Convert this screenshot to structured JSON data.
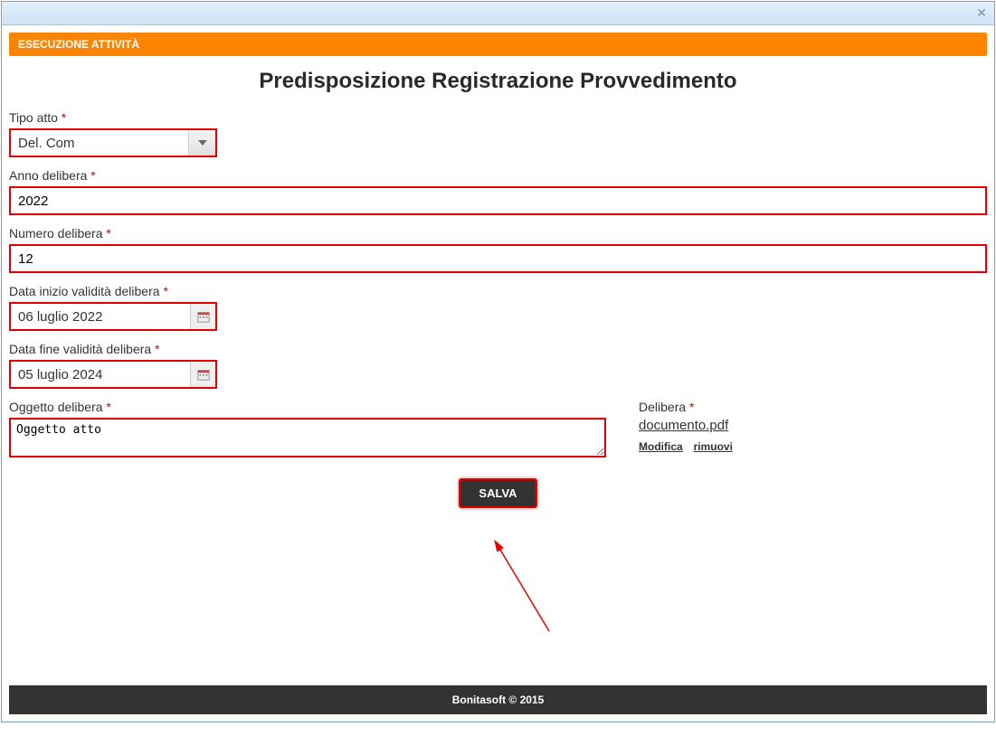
{
  "header": {
    "bar_title": "ESECUZIONE ATTIVITÀ",
    "page_title": "Predisposizione Registrazione Provvedimento"
  },
  "fields": {
    "tipo_atto": {
      "label": "Tipo atto",
      "value": "Del. Com"
    },
    "anno_delibera": {
      "label": "Anno delibera",
      "value": "2022"
    },
    "numero_delibera": {
      "label": "Numero delibera",
      "value": "12"
    },
    "data_inizio": {
      "label": "Data inizio validità delibera",
      "value": "06 luglio 2022"
    },
    "data_fine": {
      "label": "Data fine validità delibera",
      "value": "05 luglio 2024"
    },
    "oggetto": {
      "label": "Oggetto delibera",
      "value": "Oggetto atto"
    },
    "delibera": {
      "label": "Delibera",
      "filename": "documento.pdf",
      "modify": "Modifica",
      "remove": "rimuovi"
    }
  },
  "buttons": {
    "save": "SALVA"
  },
  "footer": "Bonitasoft © 2015",
  "required_marker": "*"
}
